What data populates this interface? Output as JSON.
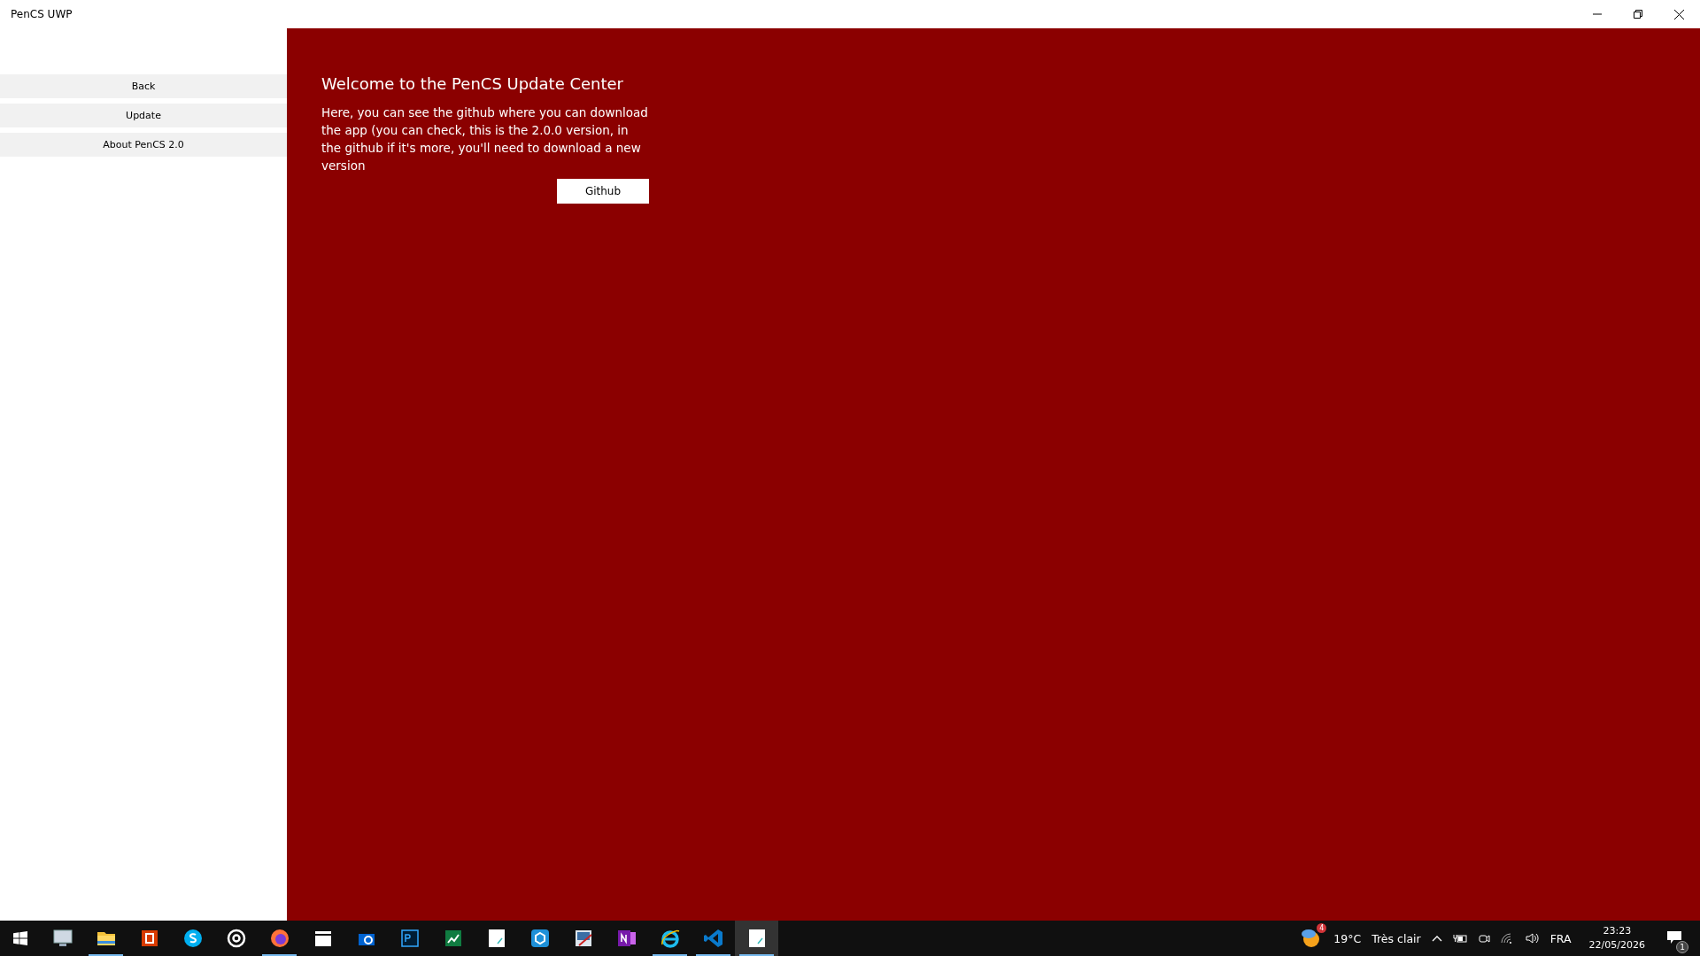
{
  "window": {
    "title": "PenCS UWP"
  },
  "sidebar": {
    "items": [
      {
        "label": "Back"
      },
      {
        "label": "Update"
      },
      {
        "label": "About PenCS 2.0"
      }
    ]
  },
  "content": {
    "heading": "Welcome to the PenCS Update Center",
    "body": "Here, you can see the github where you can download the app (you can check, this is the 2.0.0 version, in the github if it's more, you'll need to download a new version",
    "button": "Github"
  },
  "taskbar": {
    "apps": [
      {
        "kind": "monitor",
        "running": false,
        "selected": false
      },
      {
        "kind": "folder",
        "running": true,
        "selected": false
      },
      {
        "kind": "office",
        "running": false,
        "selected": false
      },
      {
        "kind": "skype",
        "running": false,
        "selected": false
      },
      {
        "kind": "ring",
        "running": false,
        "selected": false
      },
      {
        "kind": "firefox",
        "running": true,
        "selected": false
      },
      {
        "kind": "clapper",
        "running": false,
        "selected": false
      },
      {
        "kind": "camera",
        "running": false,
        "selected": false
      },
      {
        "kind": "photoshop",
        "running": false,
        "selected": false
      },
      {
        "kind": "chart",
        "running": false,
        "selected": false
      },
      {
        "kind": "note",
        "running": false,
        "selected": false
      },
      {
        "kind": "cube",
        "running": false,
        "selected": false
      },
      {
        "kind": "paint",
        "running": false,
        "selected": false
      },
      {
        "kind": "onenote",
        "running": false,
        "selected": false
      },
      {
        "kind": "ie",
        "running": true,
        "selected": false
      },
      {
        "kind": "vscode",
        "running": true,
        "selected": false
      },
      {
        "kind": "note",
        "running": true,
        "selected": true
      }
    ],
    "weather_badge": "4",
    "temperature": "19°C",
    "weather": "Très clair",
    "language": "FRA",
    "time": "23:23",
    "date": "22/05/2026",
    "notification_count": "1"
  }
}
